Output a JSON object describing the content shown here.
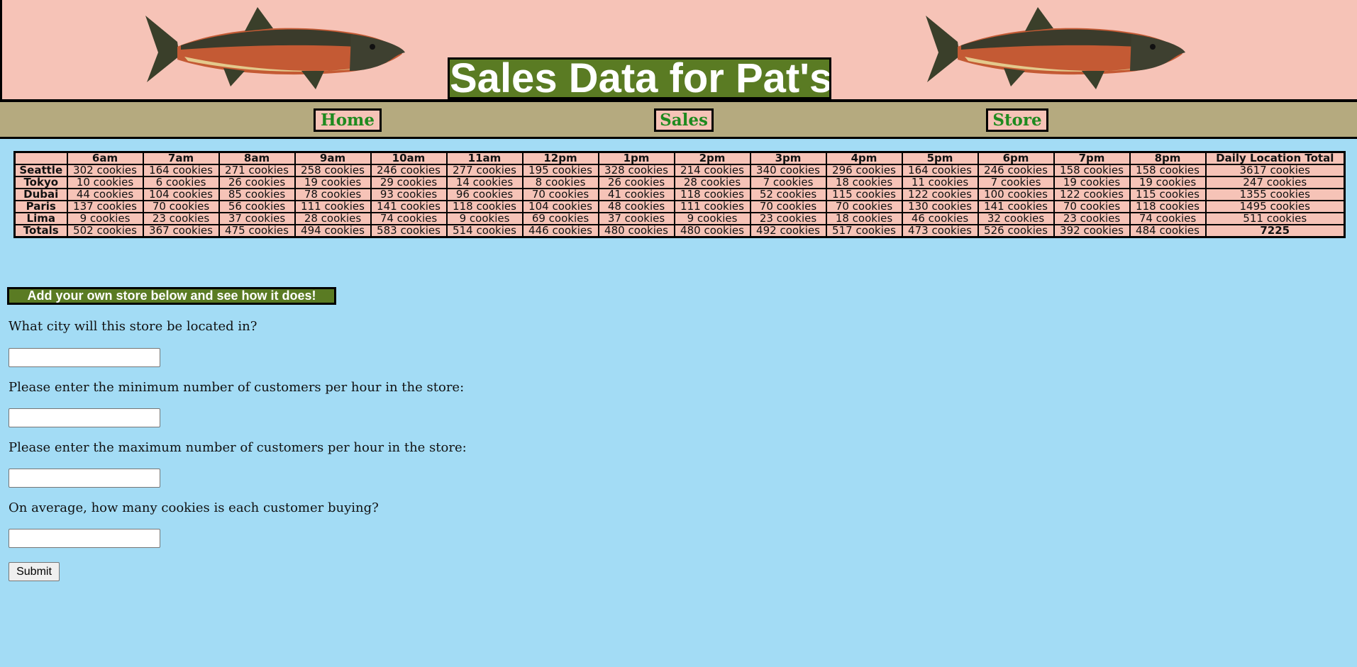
{
  "header": {
    "title": "Sales Data for Pat's",
    "logo": "salmon-fish-image"
  },
  "nav": {
    "items": [
      "Home",
      "Sales",
      "Store"
    ]
  },
  "table": {
    "headers": [
      "",
      "6am",
      "7am",
      "8am",
      "9am",
      "10am",
      "11am",
      "12pm",
      "1pm",
      "2pm",
      "3pm",
      "4pm",
      "5pm",
      "6pm",
      "7pm",
      "8pm",
      "Daily Location Total"
    ],
    "rows": [
      [
        "Seattle",
        "302 cookies",
        "164 cookies",
        "271 cookies",
        "258 cookies",
        "246 cookies",
        "277 cookies",
        "195 cookies",
        "328 cookies",
        "214 cookies",
        "340 cookies",
        "296 cookies",
        "164 cookies",
        "246 cookies",
        "158 cookies",
        "158 cookies",
        "3617 cookies"
      ],
      [
        "Tokyo",
        "10 cookies",
        "6 cookies",
        "26 cookies",
        "19 cookies",
        "29 cookies",
        "14 cookies",
        "8 cookies",
        "26 cookies",
        "28 cookies",
        "7 cookies",
        "18 cookies",
        "11 cookies",
        "7 cookies",
        "19 cookies",
        "19 cookies",
        "247 cookies"
      ],
      [
        "Dubai",
        "44 cookies",
        "104 cookies",
        "85 cookies",
        "78 cookies",
        "93 cookies",
        "96 cookies",
        "70 cookies",
        "41 cookies",
        "118 cookies",
        "52 cookies",
        "115 cookies",
        "122 cookies",
        "100 cookies",
        "122 cookies",
        "115 cookies",
        "1355 cookies"
      ],
      [
        "Paris",
        "137 cookies",
        "70 cookies",
        "56 cookies",
        "111 cookies",
        "141 cookies",
        "118 cookies",
        "104 cookies",
        "48 cookies",
        "111 cookies",
        "70 cookies",
        "70 cookies",
        "130 cookies",
        "141 cookies",
        "70 cookies",
        "118 cookies",
        "1495 cookies"
      ],
      [
        "Lima",
        "9 cookies",
        "23 cookies",
        "37 cookies",
        "28 cookies",
        "74 cookies",
        "9 cookies",
        "69 cookies",
        "37 cookies",
        "9 cookies",
        "23 cookies",
        "18 cookies",
        "46 cookies",
        "32 cookies",
        "23 cookies",
        "74 cookies",
        "511 cookies"
      ]
    ],
    "totals": [
      "Totals",
      "502 cookies",
      "367 cookies",
      "475 cookies",
      "494 cookies",
      "583 cookies",
      "514 cookies",
      "446 cookies",
      "480 cookies",
      "480 cookies",
      "492 cookies",
      "517 cookies",
      "473 cookies",
      "526 cookies",
      "392 cookies",
      "484 cookies",
      "7225"
    ]
  },
  "form": {
    "banner": "Add your own store below and see how it does!",
    "questions": [
      {
        "label": "What city will this store be located in?",
        "value": ""
      },
      {
        "label": "Please enter the minimum number of customers per hour in the store:",
        "value": ""
      },
      {
        "label": "Please enter the maximum number of customers per hour in the store:",
        "value": ""
      },
      {
        "label": "On average, how many cookies is each customer buying?",
        "value": ""
      }
    ],
    "submit_label": "Submit"
  },
  "colors": {
    "background": "#a3dcf5",
    "header_bg": "#f6c3b7",
    "nav_bg": "#b5aa7f",
    "accent_green": "#5a7b23",
    "link_green": "#1f8a1f"
  }
}
